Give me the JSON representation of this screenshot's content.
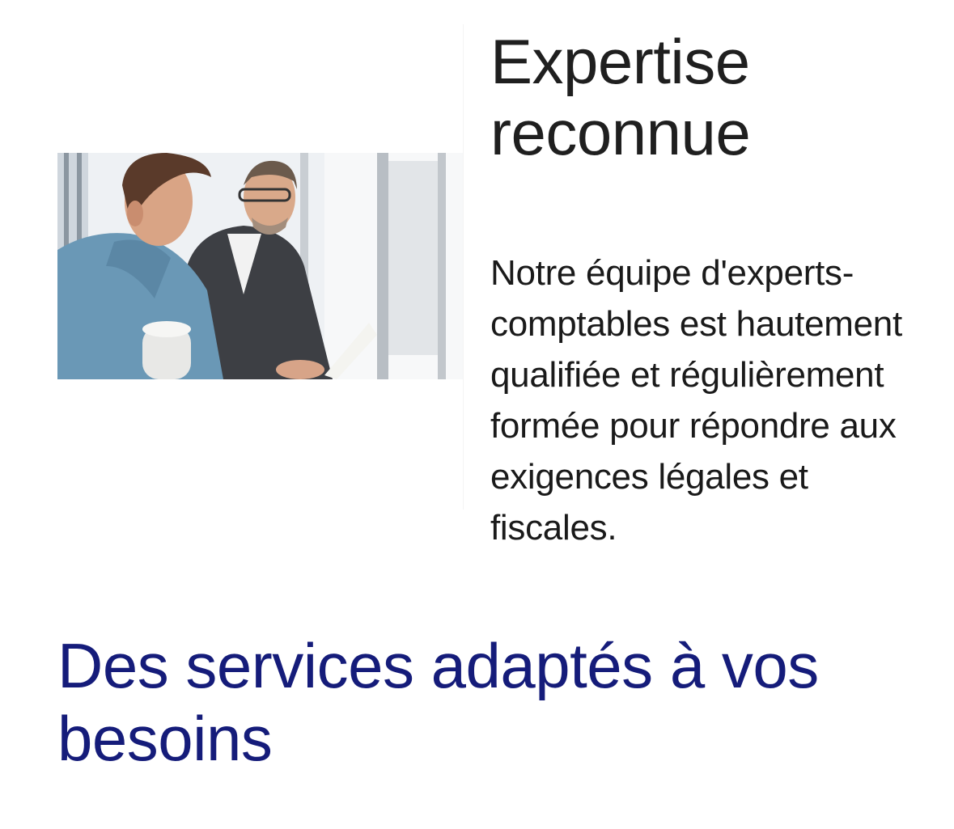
{
  "feature": {
    "image_description_icon": "photo-two-men-office",
    "heading": "Expertise reconnue",
    "body": "Notre équipe d'experts-comptables est hautement qualifiée et régulièrement formée pour répondre aux exigences légales et fiscales."
  },
  "services": {
    "title": "Des services adaptés à vos besoins"
  },
  "colors": {
    "heading": "#1f1f1f",
    "body": "#1a1a1a",
    "section_title": "#151c7a"
  }
}
